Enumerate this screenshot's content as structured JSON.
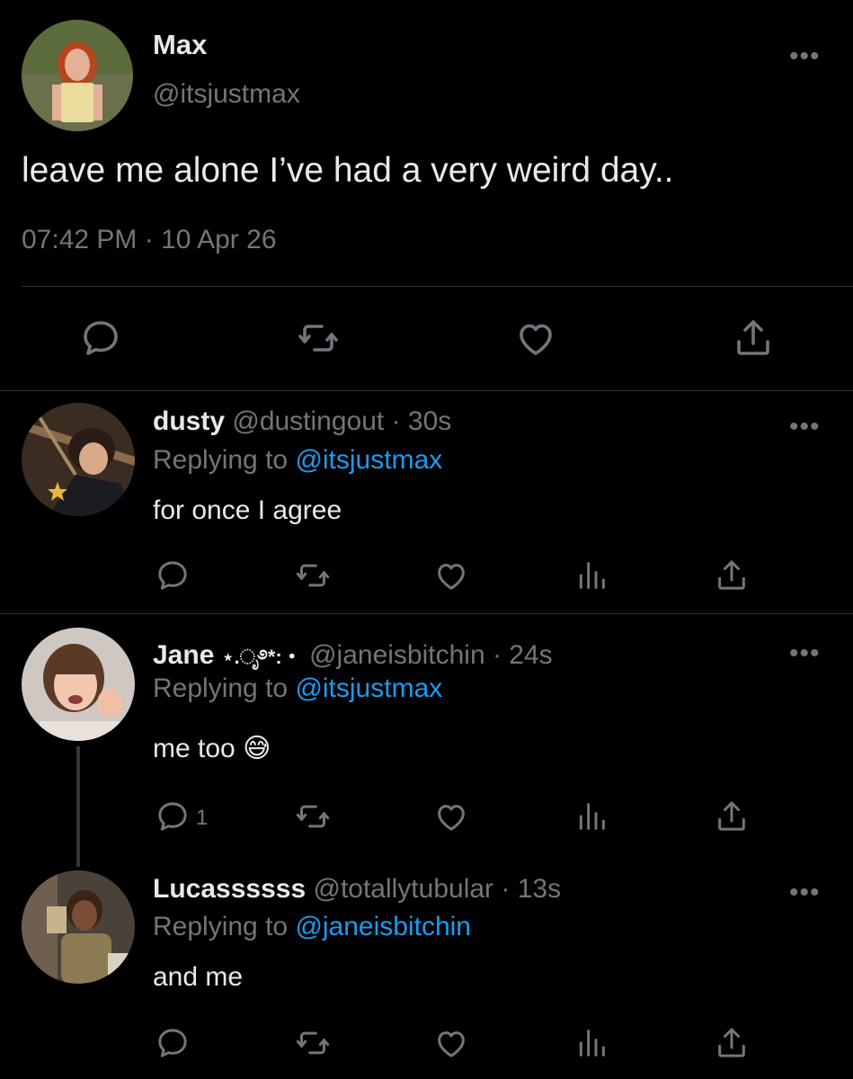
{
  "main_tweet": {
    "display_name": "Max",
    "handle": "@itsjustmax",
    "text": "leave me alone I’ve had a very weird day..",
    "timestamp": "07:42 PM · 10 Apr 26",
    "more": "•••",
    "actions": [
      "comment-icon",
      "retweet-icon",
      "like-icon",
      "share-icon"
    ]
  },
  "replies": [
    {
      "display_name": "dusty",
      "handle": "@dustingout",
      "time": "· 30s",
      "replying_prefix": "Replying to",
      "replying_to": "@itsjustmax",
      "text": "for once I agree",
      "more": "•••",
      "reply_count": ""
    },
    {
      "display_name": "Jane",
      "name_symbols": "⋆.ೃ࿔*:・",
      "handle": "@janeisbitchin",
      "time": "· 24s",
      "replying_prefix": "Replying to",
      "replying_to": "@itsjustmax",
      "text": "me too",
      "emoji": "😅",
      "more": "•••",
      "reply_count": "1"
    },
    {
      "display_name": "Lucassssss",
      "handle": "@totallytubular",
      "time": "· 13s",
      "replying_prefix": "Replying to",
      "replying_to": "@janeisbitchin",
      "text": "and me",
      "more": "•••",
      "reply_count": ""
    }
  ],
  "colors": {
    "background": "#000000",
    "text": "#e7e9ea",
    "secondary": "#71767b",
    "link": "#1d9bf0",
    "divider": "#2f3336"
  }
}
